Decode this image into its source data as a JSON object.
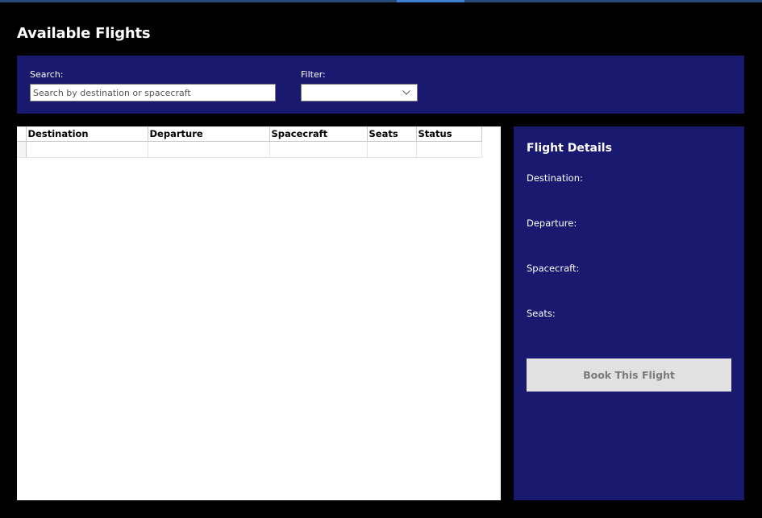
{
  "header": {
    "title": "Available Flights"
  },
  "search": {
    "label": "Search:",
    "placeholder": "Search by destination or spacecraft",
    "value": ""
  },
  "filter": {
    "label": "Filter:",
    "selected": "",
    "icon": "chevron-down-icon"
  },
  "grid": {
    "columns": [
      "Destination",
      "Departure",
      "Spacecraft",
      "Seats",
      "Status"
    ],
    "rows": []
  },
  "details": {
    "title": "Flight Details",
    "destination_label": "Destination:",
    "departure_label": "Departure:",
    "spacecraft_label": "Spacecraft:",
    "seats_label": "Seats:",
    "destination_value": "",
    "departure_value": "",
    "spacecraft_value": "",
    "seats_value": "",
    "book_button": "Book This Flight"
  },
  "colors": {
    "background": "#000000",
    "panel": "#191970",
    "button_disabled_bg": "#e1e1e1",
    "button_disabled_text": "#7a7a7a"
  }
}
